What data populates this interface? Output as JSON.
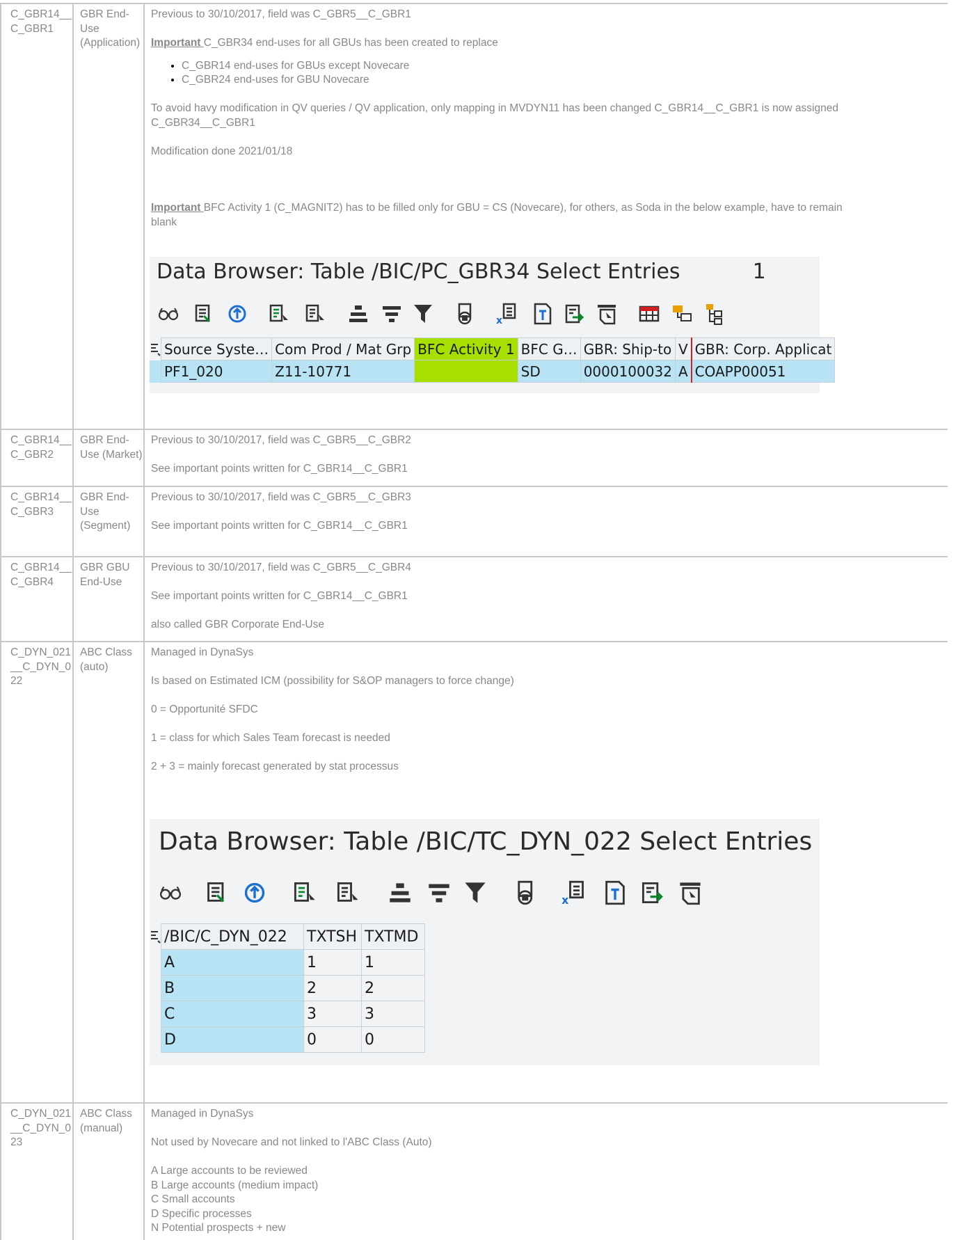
{
  "rows": [
    {
      "code": "C_GBR14__C_GBR1",
      "name": "GBR End-Use (Application)",
      "desc": {
        "p1": "Previous to 30/10/2017, field was C_GBR5__C_GBR1",
        "imp1_label": "Important ",
        "imp1_text": "C_GBR34 end-uses for all GBUs  has been created to replace",
        "bullets": [
          "C_GBR14 end-uses for GBUs except Novecare",
          "C_GBR24 end-uses for GBU Novecare"
        ],
        "p2a": "To avoid havy modification in QV queries / QV application, only mapping in MVDYN11 has been changed C_GBR14__C_GBR1 is now assigned",
        "p2b": "C_GBR34__C_GBR1",
        "p3": "Modification done 2021/01/18",
        "imp2_label": "Important ",
        "imp2_text": "BFC Activity 1 (C_MAGNIT2) has to be filled only for GBU = CS (Novecare), for others, as Soda in the below example, have to remain",
        "imp2_cont": "blank"
      },
      "sap": {
        "title": "Data Browser: Table /BIC/PC_GBR34 Select Entries",
        "count": "1",
        "headers": [
          "Source Syste…",
          "Com Prod / Mat Grp",
          "BFC Activity 1",
          "BFC G…",
          "GBR: Ship-to",
          "V",
          "GBR: Corp. Applicat"
        ],
        "row": [
          "PF1_020",
          "Z11-10771",
          "",
          "SD",
          "0000100032",
          "A",
          "COAPP00051"
        ],
        "highlight_color": "#a7e000"
      }
    },
    {
      "code": "C_GBR14__C_GBR2",
      "name": "GBR End-Use (Market)",
      "desc": {
        "p1": "Previous to 30/10/2017, field was C_GBR5__C_GBR2",
        "p2": "See important points written for C_GBR14__C_GBR1"
      }
    },
    {
      "code": "C_GBR14__C_GBR3",
      "name": "GBR End-Use (Segment)",
      "desc": {
        "p1": "Previous to 30/10/2017, field was C_GBR5__C_GBR3",
        "p2": "See important points written for C_GBR14__C_GBR1"
      }
    },
    {
      "code": "C_GBR14__C_GBR4",
      "name": "GBR GBU End-Use",
      "desc": {
        "p1": "Previous to 30/10/2017, field was C_GBR5__C_GBR4",
        "p2": "See important points written for C_GBR14__C_GBR1",
        "p3": "also called GBR Corporate End-Use"
      }
    },
    {
      "code": "C_DYN_021__C_DYN_022",
      "name": "ABC Class (auto)",
      "desc": {
        "p1": "Managed in DynaSys",
        "p2": "Is based on Estimated ICM (possibility for S&OP managers to force change)",
        "p3": "0 = Opportunité SFDC",
        "p4": "1 = class for which Sales Team forecast is needed",
        "p5": "2 + 3 = mainly forecast generated by stat processus"
      },
      "sap": {
        "title": "Data Browser: Table /BIC/TC_DYN_022 Select Entries",
        "headers": [
          "/BIC/C_DYN_022",
          "TXTSH",
          "TXTMD"
        ],
        "rows": [
          [
            "A",
            "1",
            "1"
          ],
          [
            "B",
            "2",
            "2"
          ],
          [
            "C",
            "3",
            "3"
          ],
          [
            "D",
            "0",
            "0"
          ]
        ]
      }
    },
    {
      "code": "C_DYN_021__C_DYN_023",
      "name": "ABC Class (manual)",
      "desc": {
        "p1": "Managed in DynaSys",
        "p2": "Not used by Novecare and not linked to l'ABC Class (Auto)",
        "lines": [
          "A Large accounts to be reviewed",
          "B Large accounts (medium impact)",
          "C Small accounts",
          "D Specific processes",
          "N Potential prospects + new"
        ]
      }
    }
  ],
  "icons": [
    "glasses-icon",
    "select-details-icon",
    "refresh-icon",
    "sort-ascending-icon",
    "sort-descending-icon",
    "total-icon",
    "subtotal-icon",
    "filter-icon",
    "print-icon",
    "excel-icon",
    "text-icon",
    "export-icon",
    "layout-icon",
    "grid-icon",
    "hierarchy-icon",
    "tree-icon"
  ]
}
